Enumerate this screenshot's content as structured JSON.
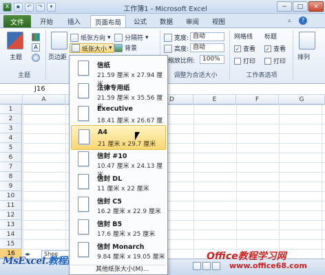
{
  "window": {
    "title": "工作簿1 - Microsoft Excel",
    "controls": [
      "−",
      "□",
      "×"
    ]
  },
  "tabs": {
    "file": "文件",
    "items": [
      "开始",
      "插入",
      "页面布局",
      "公式",
      "数据",
      "审阅",
      "视图"
    ],
    "active": "页面布局"
  },
  "ribbon": {
    "themes": {
      "label": "主题",
      "group": "主题"
    },
    "margins": "页边距",
    "orientation": "纸张方向",
    "size": "纸张大小",
    "breaks": "分隔符",
    "background": "背景",
    "width_label": "宽度:",
    "width_value": "自动",
    "height_label": "高度:",
    "height_value": "自动",
    "scale_label": "缩放比例:",
    "scale_value": "100%",
    "scale_group": "调整为合适大小",
    "gridlines": "网格线",
    "headings": "标题",
    "view": "查看",
    "print": "打印",
    "sheet_options_group": "工作表选项",
    "arrange": "排列"
  },
  "formula_bar": {
    "name_box": "J16"
  },
  "columns": [
    "A",
    "B",
    "C",
    "D",
    "E",
    "F",
    "G"
  ],
  "rows": [
    "1",
    "2",
    "3",
    "4",
    "5",
    "6",
    "7",
    "8",
    "9",
    "10",
    "11",
    "12",
    "13",
    "14",
    "15",
    "16"
  ],
  "selected_row": "16",
  "sheet_tab": "Shee",
  "paper_menu": {
    "items": [
      {
        "name": "信纸",
        "size": "21.59 厘米 x 27.94 厘米"
      },
      {
        "name": "法律专用纸",
        "size": "21.59 厘米 x 35.56 厘米"
      },
      {
        "name": "Executive",
        "size": "18.41 厘米 x 26.67 厘米"
      },
      {
        "name": "A4",
        "size": "21 厘米 x 29.7 厘米"
      },
      {
        "name": "信封 #10",
        "size": "10.47 厘米 x 24.13 厘米"
      },
      {
        "name": "信封 DL",
        "size": "11 厘米 x 22 厘米"
      },
      {
        "name": "信封 C5",
        "size": "16.2 厘米 x 22.9 厘米"
      },
      {
        "name": "信封 B5",
        "size": "17.6 厘米 x 25 厘米"
      },
      {
        "name": "信封 Monarch",
        "size": "9.84 厘米 x 19.05 厘米"
      }
    ],
    "highlighted": "A4",
    "more": "其他纸张大小(M)..."
  },
  "watermarks": {
    "left_brand": "MsExcel",
    "left_suffix": ".教程网",
    "right_brand": "Office教程学习网",
    "right_url": "www.office68.com"
  }
}
